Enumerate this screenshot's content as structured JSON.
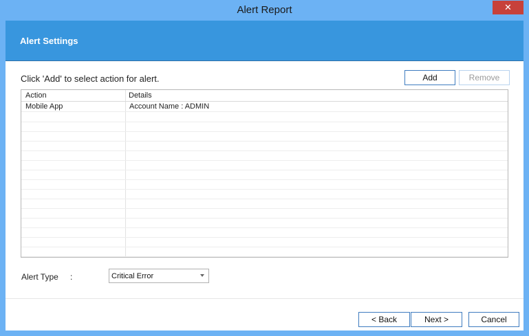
{
  "window": {
    "title": "Alert Report",
    "close_glyph": "✕"
  },
  "banner": {
    "title": "Alert Settings"
  },
  "instruction": "Click 'Add' to select action for alert.",
  "buttons": {
    "add": "Add",
    "remove": "Remove",
    "back": "< Back",
    "next": "Next >",
    "cancel": "Cancel"
  },
  "grid": {
    "columns": [
      "Action",
      "Details"
    ],
    "rows": [
      {
        "action": "Mobile App",
        "details": "Account Name : ADMIN"
      }
    ]
  },
  "alert_type": {
    "label": "Alert Type",
    "colon": ":",
    "selected": "Critical Error"
  },
  "colors": {
    "titlebar": "#6cb2f4",
    "banner": "#3896de",
    "close": "#c7413a"
  }
}
